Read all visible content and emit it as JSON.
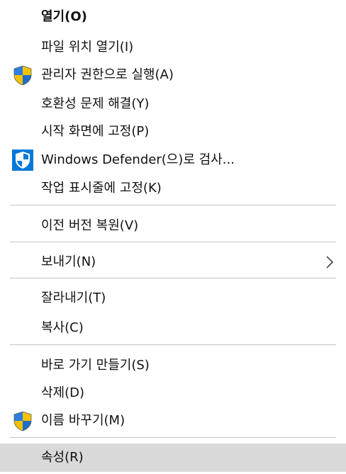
{
  "menu": {
    "items": [
      {
        "label": "열기(O)",
        "bold": true
      },
      {
        "label": "파일 위치 열기(I)"
      },
      {
        "label": "관리자 권한으로 실행(A)",
        "icon": "uac-shield-icon"
      },
      {
        "label": "호환성 문제 해결(Y)"
      },
      {
        "label": "시작 화면에 고정(P)"
      },
      {
        "label": "Windows Defender(으)로 검사...",
        "icon": "windows-defender-icon"
      },
      {
        "label": "작업 표시줄에 고정(K)"
      },
      {
        "label": "이전 버전 복원(V)"
      },
      {
        "label": "보내기(N)",
        "submenu": true
      },
      {
        "label": "잘라내기(T)"
      },
      {
        "label": "복사(C)"
      },
      {
        "label": "바로 가기 만들기(S)"
      },
      {
        "label": "삭제(D)"
      },
      {
        "label": "이름 바꾸기(M)",
        "icon": "uac-shield-icon"
      },
      {
        "label": "속성(R)",
        "highlighted": true
      }
    ]
  },
  "colors": {
    "background": "#ffffff",
    "text": "#111111",
    "separator": "#c4c4c4",
    "highlight": "#d9d9d9",
    "shield_blue": "#1e6ec8",
    "shield_yellow": "#f2c200",
    "defender_blue": "#0078d7"
  }
}
